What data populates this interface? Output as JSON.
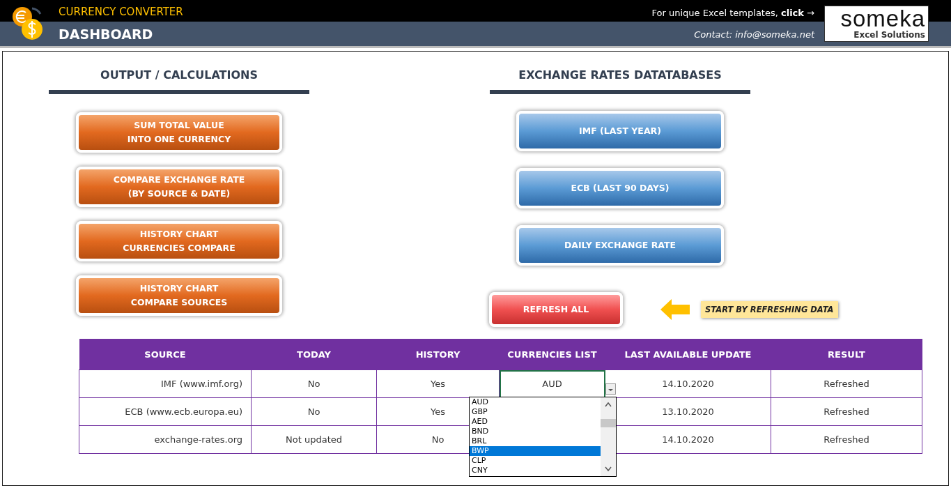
{
  "header": {
    "app_title": "CURRENCY CONVERTER",
    "page_title": "DASHBOARD",
    "promo": "For unique Excel templates, **click** →",
    "contact": "Contact: info@someka.net",
    "brand": "someka",
    "brand_tagline": "Excel Solutions"
  },
  "output": {
    "heading": "OUTPUT / CALCULATIONS",
    "buttons": [
      {
        "lines": [
          "SUM TOTAL VALUE",
          "INTO ONE CURRENCY"
        ]
      },
      {
        "lines": [
          "COMPARE EXCHANGE RATE",
          "(BY SOURCE & DATE)"
        ]
      },
      {
        "lines": [
          "HISTORY CHART",
          "CURRENCIES COMPARE"
        ]
      },
      {
        "lines": [
          "HISTORY CHART",
          "COMPARE SOURCES"
        ]
      }
    ]
  },
  "databases": {
    "heading": "EXCHANGE RATES DATATABASES",
    "buttons": [
      {
        "lines": [
          "IMF (LAST YEAR)"
        ]
      },
      {
        "lines": [
          "ECB (LAST 90 DAYS)"
        ]
      },
      {
        "lines": [
          "DAILY EXCHANGE RATE"
        ]
      }
    ],
    "refresh_button": "REFRESH ALL",
    "hint": "START BY REFRESHING DATA"
  },
  "table": {
    "columns": [
      "SOURCE",
      "TODAY",
      "HISTORY",
      "CURRENCIES LIST",
      "LAST AVAILABLE UPDATE",
      "RESULT"
    ],
    "rows": [
      {
        "cells": [
          {
            "text": "IMF (www.imf.org)",
            "selected": false
          },
          {
            "text": "No",
            "selected": false
          },
          {
            "text": "Yes",
            "selected": false
          },
          {
            "text": "AUD",
            "selected": true
          },
          {
            "text": "14.10.2020",
            "selected": false
          },
          {
            "text": "Refreshed",
            "selected": false
          }
        ]
      },
      {
        "cells": [
          {
            "text": "ECB (www.ecb.europa.eu)",
            "selected": false
          },
          {
            "text": "No",
            "selected": false
          },
          {
            "text": "Yes",
            "selected": false
          },
          null,
          {
            "text": "13.10.2020",
            "selected": false
          },
          {
            "text": "Refreshed",
            "selected": false
          }
        ]
      },
      {
        "cells": [
          {
            "text": "exchange-rates.org",
            "selected": false
          },
          {
            "text": "Not updated",
            "selected": false
          },
          {
            "text": "No",
            "selected": false
          },
          null,
          {
            "text": "14.10.2020",
            "selected": false
          },
          {
            "text": "Refreshed",
            "selected": false
          }
        ]
      }
    ]
  },
  "dropdown": {
    "options": [
      {
        "label": "AUD",
        "selected": false
      },
      {
        "label": "GBP",
        "selected": false
      },
      {
        "label": "AED",
        "selected": false
      },
      {
        "label": "BND",
        "selected": false
      },
      {
        "label": "BRL",
        "selected": false
      },
      {
        "label": "BWP",
        "selected": true
      },
      {
        "label": "CLP",
        "selected": false
      },
      {
        "label": "CNY",
        "selected": false
      }
    ]
  }
}
